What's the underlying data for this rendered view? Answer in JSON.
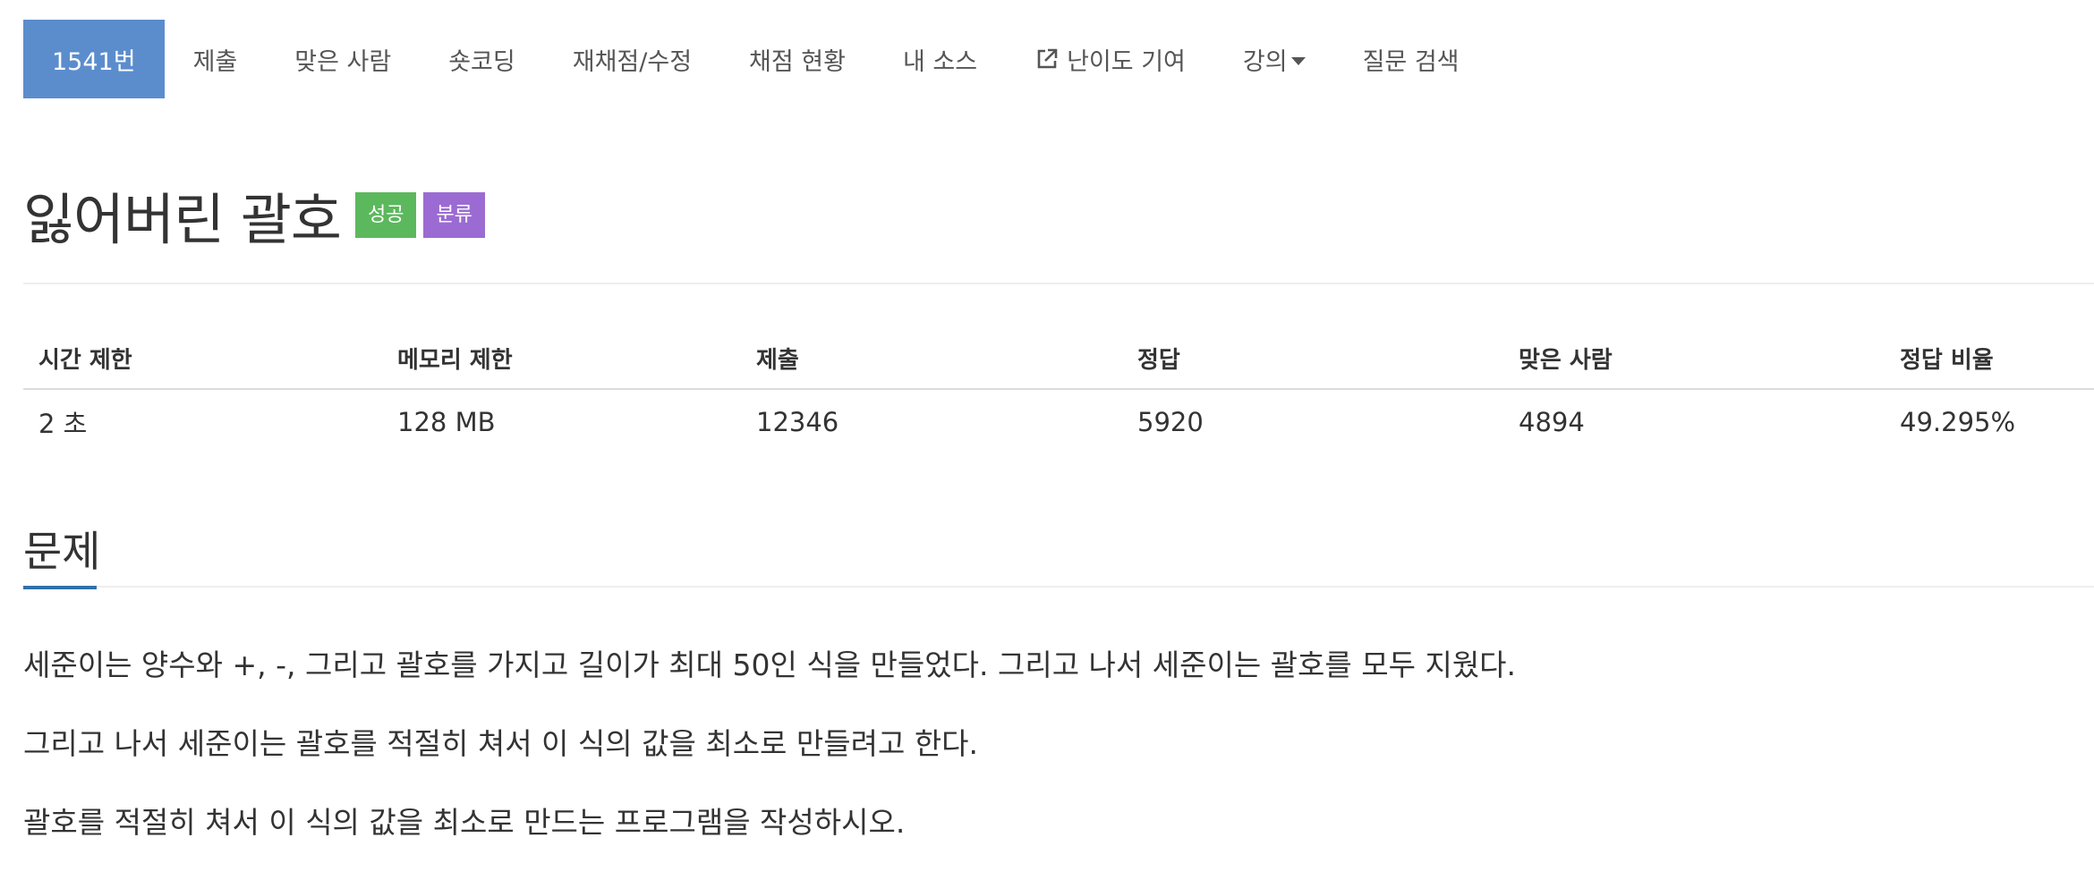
{
  "nav": {
    "items": [
      {
        "label": "1541번"
      },
      {
        "label": "제출"
      },
      {
        "label": "맞은 사람"
      },
      {
        "label": "숏코딩"
      },
      {
        "label": "재채점/수정"
      },
      {
        "label": "채점 현황"
      },
      {
        "label": "내 소스"
      },
      {
        "label": "난이도 기여",
        "icon": "external-link-icon"
      },
      {
        "label": "강의",
        "icon": "caret-down-icon"
      },
      {
        "label": "질문 검색"
      }
    ],
    "active_color": "#5b8dcd"
  },
  "problem": {
    "title": "잃어버린 괄호",
    "badges": [
      {
        "label": "성공",
        "color": "#5cb85c"
      },
      {
        "label": "분류",
        "color": "#9b6bd3"
      }
    ]
  },
  "info_table": {
    "headers": [
      "시간 제한",
      "메모리 제한",
      "제출",
      "정답",
      "맞은 사람",
      "정답 비율"
    ],
    "row": [
      "2 초",
      "128 MB",
      "12346",
      "5920",
      "4894",
      "49.295%"
    ]
  },
  "section": {
    "title": "문제",
    "accent_color": "#3071a9",
    "paragraphs": [
      "세준이는 양수와 +, -, 그리고 괄호를 가지고 길이가 최대 50인 식을 만들었다. 그리고 나서 세준이는 괄호를 모두 지웠다.",
      "그리고 나서 세준이는 괄호를 적절히 쳐서 이 식의 값을 최소로 만들려고 한다.",
      "괄호를 적절히 쳐서 이 식의 값을 최소로 만드는 프로그램을 작성하시오."
    ]
  }
}
